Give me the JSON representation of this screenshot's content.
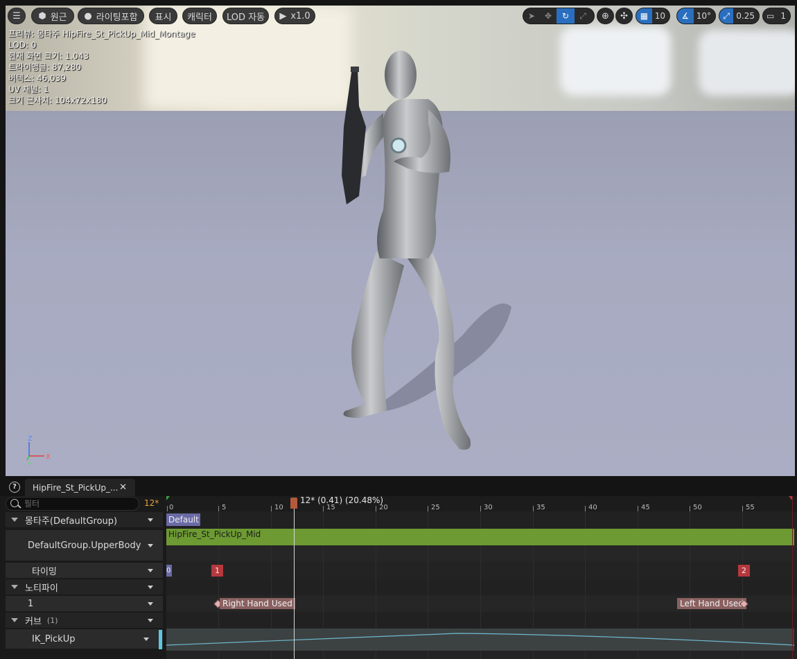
{
  "toolbar": {
    "perspective_label": "원근",
    "lighting_label": "라이팅포함",
    "show_label": "표시",
    "character_label": "캐릭터",
    "lod_label": "LOD 자동",
    "play_rate_label": "x1.0",
    "grid_snap_value": "10",
    "rotation_snap_value": "10°",
    "scale_snap_value": "0.25",
    "camera_speed_value": "1"
  },
  "viewport": {
    "stats": [
      "프리뷰: 몽타주 HipFire_St_PickUp_Mid_Montage",
      "LOD: 0",
      "현재 화면 크기: 1.043",
      "트라이앵글: 87,280",
      "버텍스: 46,039",
      "UV 채널: 1",
      "크기 근사치: 104x72x180"
    ],
    "axis": {
      "z": "Z",
      "x": "X",
      "y": "Y"
    }
  },
  "bottom": {
    "doc_tab_label": "HipFire_St_PickUp_...",
    "filter_placeholder": "필터",
    "current_frame": "12*",
    "playhead_text": "12* (0.41) (20.48%)",
    "rows": {
      "montage": "몽타주(DefaultGroup)",
      "slot": "DefaultGroup.UpperBody",
      "timing": "타이밍",
      "notifies": "노티파이",
      "notify_track": "1",
      "curves": "커브",
      "curves_count": "(1)",
      "curve_name": "IK_PickUp"
    },
    "timeline": {
      "ticks": [
        "0",
        "5",
        "10",
        "15",
        "20",
        "25",
        "30",
        "35",
        "40",
        "45",
        "50",
        "55"
      ],
      "default_label": "Default",
      "segment_label": "HipFire_St_PickUp_Mid",
      "section_0": "0",
      "section_1": "1",
      "section_2": "2",
      "notify_right": "Right Hand Used",
      "notify_left": "Left Hand Used"
    }
  },
  "colors": {
    "accent": "#2a6fbf",
    "segment": "#6d9a32",
    "section": "#b5383d",
    "notify": "#8a6060",
    "curve": "#5cc8e0",
    "frame_text": "#e8a33a"
  }
}
